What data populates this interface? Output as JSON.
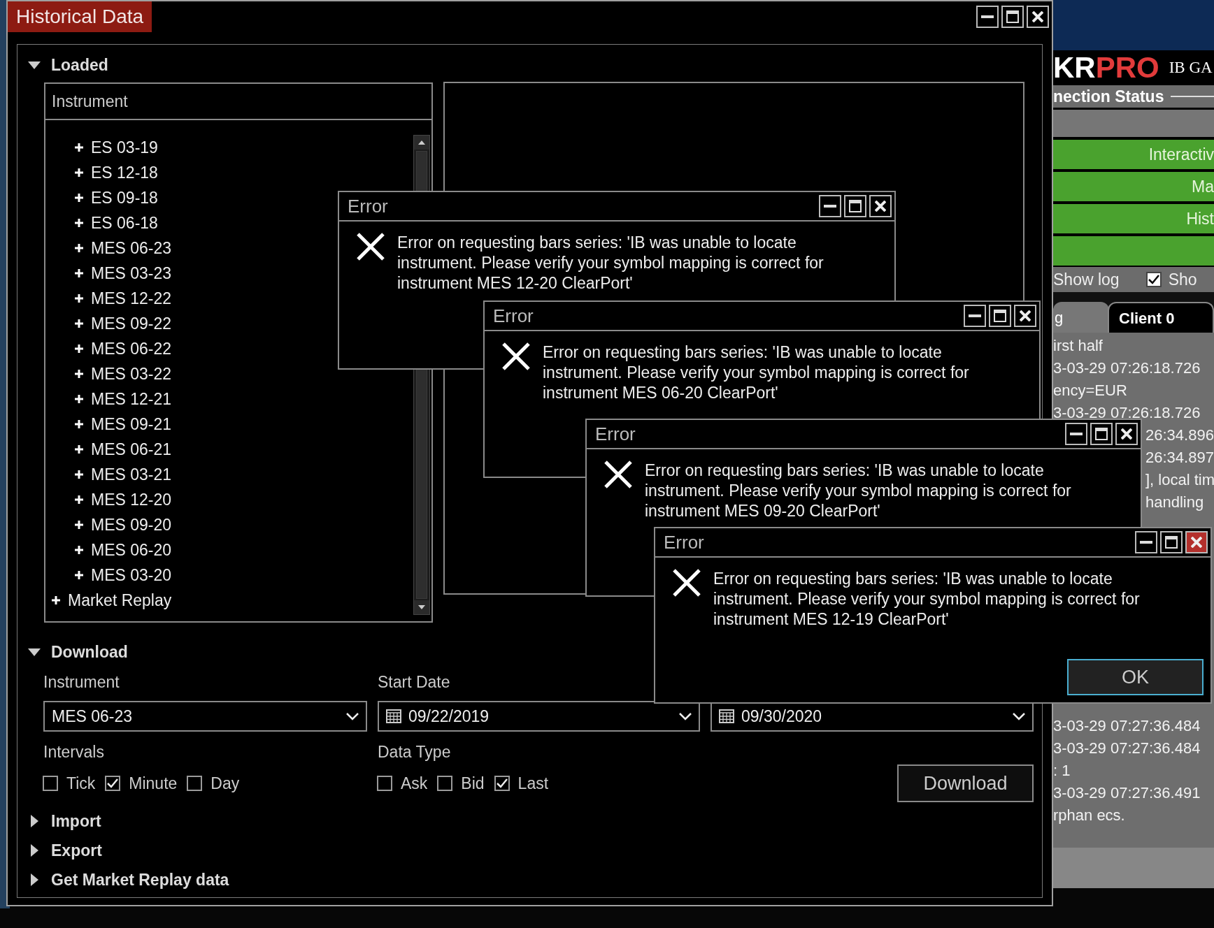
{
  "window": {
    "title": "Historical Data"
  },
  "loaded": {
    "label": "Loaded",
    "expanded": true,
    "list_header": "Instrument",
    "items": [
      {
        "label": "ES 03-19",
        "kind": "contract",
        "expanded": false
      },
      {
        "label": "ES 12-18",
        "kind": "contract",
        "expanded": false
      },
      {
        "label": "ES 09-18",
        "kind": "contract",
        "expanded": false
      },
      {
        "label": "ES 06-18",
        "kind": "contract",
        "expanded": false
      },
      {
        "label": "MES 06-23",
        "kind": "contract",
        "expanded": false
      },
      {
        "label": "MES 03-23",
        "kind": "contract",
        "expanded": false
      },
      {
        "label": "MES 12-22",
        "kind": "contract",
        "expanded": false
      },
      {
        "label": "MES 09-22",
        "kind": "contract",
        "expanded": false
      },
      {
        "label": "MES 06-22",
        "kind": "contract",
        "expanded": false
      },
      {
        "label": "MES 03-22",
        "kind": "contract",
        "expanded": false
      },
      {
        "label": "MES 12-21",
        "kind": "contract",
        "expanded": false
      },
      {
        "label": "MES 09-21",
        "kind": "contract",
        "expanded": false
      },
      {
        "label": "MES 06-21",
        "kind": "contract",
        "expanded": false
      },
      {
        "label": "MES 03-21",
        "kind": "contract",
        "expanded": false
      },
      {
        "label": "MES 12-20",
        "kind": "contract",
        "expanded": false
      },
      {
        "label": "MES 09-20",
        "kind": "contract",
        "expanded": false
      },
      {
        "label": "MES 06-20",
        "kind": "contract",
        "expanded": false
      },
      {
        "label": "MES 03-20",
        "kind": "contract",
        "expanded": false
      },
      {
        "label": "Market Replay",
        "kind": "group",
        "expanded": false
      }
    ]
  },
  "download": {
    "label": "Download",
    "expanded": true,
    "instrument_label": "Instrument",
    "instrument": "MES 06-23",
    "start_date_label": "Start Date",
    "start_date": "09/22/2019",
    "end_date": "09/30/2020",
    "intervals_label": "Intervals",
    "intervals": [
      {
        "label": "Tick",
        "checked": false
      },
      {
        "label": "Minute",
        "checked": true
      },
      {
        "label": "Day",
        "checked": false
      }
    ],
    "data_type_label": "Data Type",
    "data_types": [
      {
        "label": "Ask",
        "checked": false
      },
      {
        "label": "Bid",
        "checked": false
      },
      {
        "label": "Last",
        "checked": true
      }
    ],
    "button": "Download"
  },
  "sections": [
    {
      "label": "Import",
      "expanded": false
    },
    {
      "label": "Export",
      "expanded": false
    },
    {
      "label": "Get Market Replay data",
      "expanded": false
    }
  ],
  "error_dialogs": [
    {
      "title": "Error",
      "message": "Error on requesting bars series: 'IB was unable to locate instrument. Please verify your symbol mapping is correct for instrument MES 12-20 ClearPort'",
      "active": false
    },
    {
      "title": "Error",
      "message": "Error on requesting bars series: 'IB was unable to locate instrument. Please verify your symbol mapping is correct for instrument MES 06-20 ClearPort'",
      "active": false
    },
    {
      "title": "Error",
      "message": "Error on requesting bars series: 'IB was unable to locate instrument. Please verify your symbol mapping is correct for instrument MES 09-20 ClearPort'",
      "active": false
    },
    {
      "title": "Error",
      "message": "Error on requesting bars series: 'IB was unable to locate instrument. Please verify your symbol mapping is correct for instrument MES 12-19 ClearPort'",
      "active": true,
      "buttons": [
        "OK"
      ]
    }
  ],
  "background_window": {
    "logo_white": "KR",
    "logo_red": "PRO",
    "subtitle": "IB GA",
    "section": "nection Status",
    "status_bars": [
      {
        "color": "#767676"
      },
      {
        "label": "Interactiv",
        "color": "#4aa22e"
      },
      {
        "label": "Ma",
        "color": "#4aa22e"
      },
      {
        "label": "Hist",
        "color": "#4aa22e"
      },
      {
        "color": "#4aa22e"
      }
    ],
    "options": [
      {
        "label": "Show log"
      },
      {
        "label": "Sho",
        "checked": true
      }
    ],
    "tabs": [
      {
        "label": "g",
        "selected": false
      },
      {
        "label": "Client 0",
        "selected": true
      }
    ],
    "log_top": [
      {
        "text": "irst half",
        "kind": "full"
      },
      {
        "text": "3-03-29 07:26:18.726",
        "kind": "full"
      },
      {
        "text": "ency=EUR",
        "kind": "full"
      },
      {
        "text": "3-03-29 07:26:18.726",
        "kind": "full"
      },
      {
        "text": "26:34.896",
        "kind": "cut"
      },
      {
        "text": "26:34.897",
        "kind": "cut"
      },
      {
        "text": "], local tim",
        "kind": "cut"
      },
      {
        "text": "handling",
        "kind": "cut"
      }
    ],
    "log_bottom": [
      {
        "text": "3-03-29 07:27:36.484",
        "kind": "full"
      },
      {
        "text": "3-03-29 07:27:36.484",
        "kind": "full"
      },
      {
        "text": ": 1",
        "kind": "full"
      },
      {
        "text": "3-03-29 07:27:36.491",
        "kind": "full"
      },
      {
        "text": "rphan ecs.",
        "kind": "full"
      }
    ]
  }
}
